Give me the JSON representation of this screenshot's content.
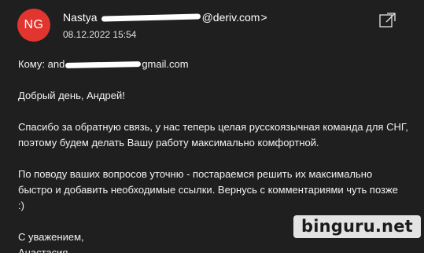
{
  "header": {
    "avatar_initials": "NG",
    "avatar_color": "#e3352f",
    "sender_name": "Nastya",
    "sender_domain": "@deriv.com",
    "sender_chevron": ">",
    "date": "08.12.2022 15:54",
    "popout_icon": "open-in-new-window-icon"
  },
  "message": {
    "to_label": "Кому: and",
    "to_suffix": "gmail.com",
    "greeting": "Добрый день, Андрей!",
    "paragraph1_line1": "Спасибо за обратную связь, у нас теперь целая русскоязычная команда для СНГ,",
    "paragraph1_line2": "поэтому будем делать Вашу работу максимально комфортной.",
    "paragraph2_line1": "По поводу ваших вопросов уточню - постараемся решить их максимально",
    "paragraph2_line2": "быстро и добавить необходимые ссылки. Вернусь с комментариями чуть позже",
    "paragraph2_line3": ":)",
    "closing": "С уважением,",
    "signature": "Анастасия"
  },
  "watermark": {
    "text": "binguru.net"
  }
}
